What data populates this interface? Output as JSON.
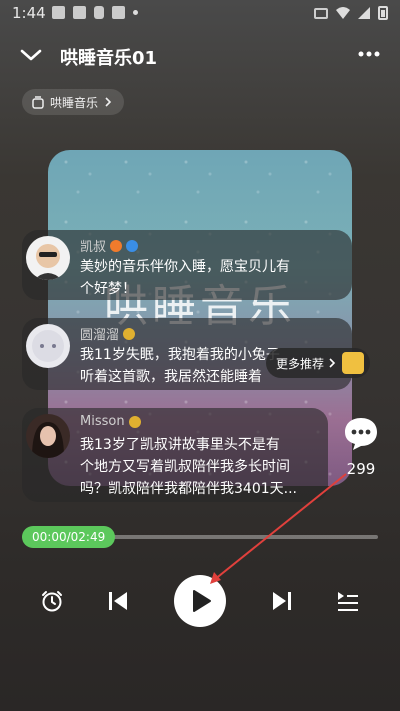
{
  "status_bar": {
    "time": "1:44"
  },
  "header": {
    "title": "哄睡音乐01"
  },
  "category_pill": {
    "label": "哄睡音乐"
  },
  "cover": {
    "title": "哄睡音乐"
  },
  "comments": [
    {
      "name": "凯叔",
      "text_line1": "美妙的音乐伴你入睡，愿宝贝儿有",
      "text_line2": "个好梦！"
    },
    {
      "name": "圆溜溜",
      "text_line1": "我11岁失眠，我抱着我的小兔子",
      "text_line2": "听着这首歌，我居然还能睡着"
    },
    {
      "name": "Misson",
      "text_line1": "我13岁了凯叔讲故事里头不是有",
      "text_line2": "个地方又写着凯叔陪伴我多长时间",
      "text_line3": "吗？凯叔陪伴我都陪伴我3401天..."
    }
  ],
  "more_recommendations": {
    "label": "更多推荐"
  },
  "comment_count": "299",
  "progress": {
    "time": "00:00/02:49",
    "fraction": 0
  },
  "colors": {
    "accent_green": "#5cc85c",
    "annotation_red": "#e0403c"
  }
}
